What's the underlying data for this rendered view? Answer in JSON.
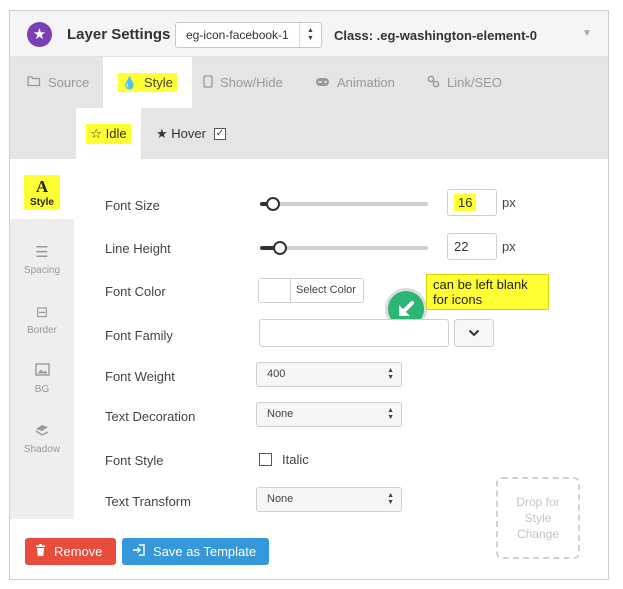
{
  "header": {
    "title": "Layer Settings -",
    "layer_select": "eg-icon-facebook-1",
    "class_label": "Class: .eg-washington-element-0",
    "logo_icon": "star-icon",
    "collapse_icon": "caret-down-icon"
  },
  "tabs": [
    {
      "label": "Source",
      "icon": "folder-icon"
    },
    {
      "label": "Style",
      "icon": "drop-icon"
    },
    {
      "label": "Show/Hide",
      "icon": "tablet-icon"
    },
    {
      "label": "Animation",
      "icon": "gamepad-icon"
    },
    {
      "label": "Link/SEO",
      "icon": "link-icon"
    }
  ],
  "subtabs": {
    "idle": "Idle",
    "hover": "Hover",
    "hover_checked": true
  },
  "sidenav": [
    {
      "label": "Style",
      "icon": "font-icon"
    },
    {
      "label": "Spacing",
      "icon": "align-icon"
    },
    {
      "label": "Border",
      "icon": "square-minus-icon"
    },
    {
      "label": "BG",
      "icon": "image-icon"
    },
    {
      "label": "Shadow",
      "icon": "shadow-icon"
    }
  ],
  "form": {
    "font_size": {
      "label": "Font Size",
      "value": "16",
      "unit": "px",
      "level": 0.08
    },
    "line_height": {
      "label": "Line Height",
      "value": "22",
      "unit": "px",
      "level": 0.12
    },
    "font_color": {
      "label": "Font Color",
      "button": "Select Color"
    },
    "font_family": {
      "label": "Font Family",
      "value": ""
    },
    "font_weight": {
      "label": "Font Weight",
      "value": "400"
    },
    "text_decoration": {
      "label": "Text Decoration",
      "value": "None"
    },
    "font_style": {
      "label": "Font Style",
      "option": "Italic",
      "checked": false
    },
    "text_transform": {
      "label": "Text Transform",
      "value": "None"
    }
  },
  "annotation": {
    "note": "can be left blank for icons"
  },
  "dropzone": "Drop for Style Change",
  "buttons": {
    "remove": "Remove",
    "save_template": "Save as Template"
  },
  "colors": {
    "logo": "#7b3fb3",
    "highlight": "#ffff33",
    "remove": "#e74c3c",
    "save": "#3498db",
    "arrow": "#2bb673"
  }
}
